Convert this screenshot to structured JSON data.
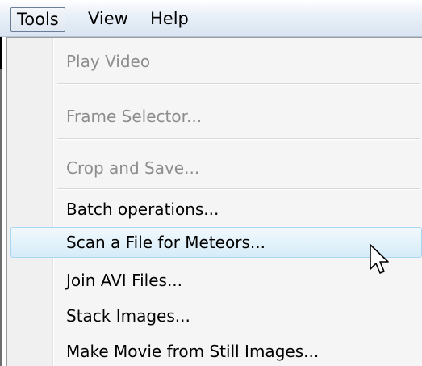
{
  "menubar": {
    "items": [
      {
        "label": "Tools"
      },
      {
        "label": "View"
      },
      {
        "label": "Help"
      }
    ]
  },
  "menu": {
    "items": [
      {
        "label": "Play Video",
        "enabled": false
      },
      {
        "label": "Frame Selector...",
        "enabled": false
      },
      {
        "label": "Crop and Save...",
        "enabled": false
      },
      {
        "label": "Batch operations...",
        "enabled": true
      },
      {
        "label": "Scan a File for Meteors...",
        "enabled": true,
        "hovered": true
      },
      {
        "label": "Join AVI Files...",
        "enabled": true
      },
      {
        "label": "Stack Images...",
        "enabled": true
      },
      {
        "label": "Make Movie from Still Images...",
        "enabled": true
      }
    ]
  },
  "cursor": {
    "icon": "arrow-pointer-icon"
  },
  "colors": {
    "disabled_text": "#8d8d8d",
    "hover_border": "#a9d7f3",
    "hover_fill": "#e3f2fb"
  }
}
